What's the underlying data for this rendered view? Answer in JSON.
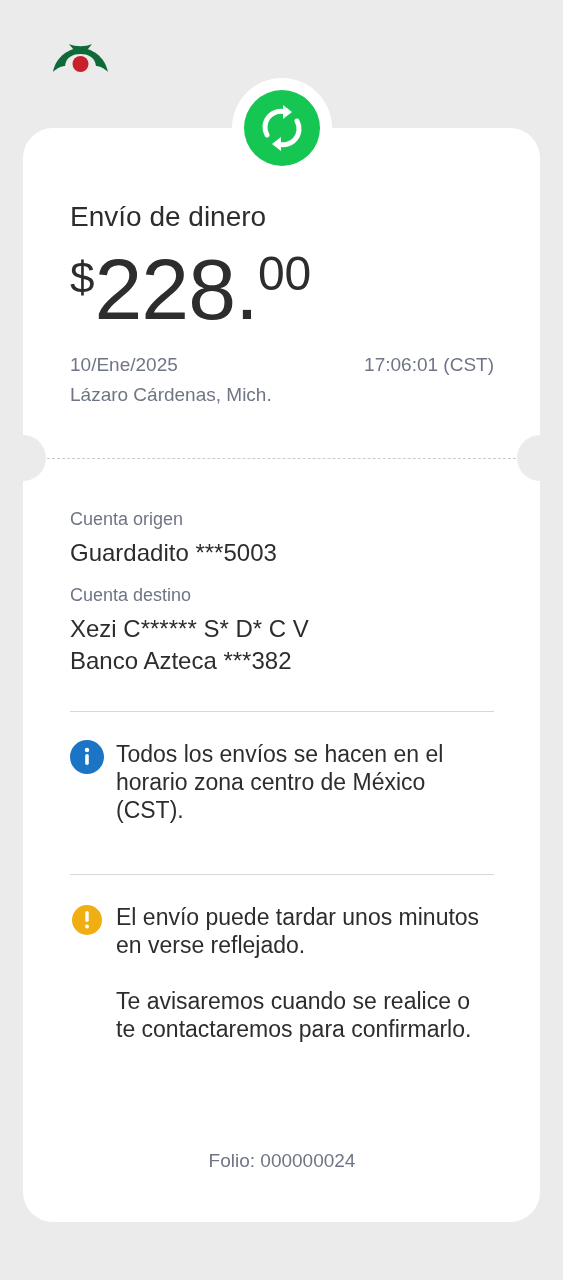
{
  "title": "Envío de dinero",
  "amount": {
    "currency": "$",
    "integer": "228.",
    "cents": "00"
  },
  "date": "10/Ene/2025",
  "time": "17:06:01 (CST)",
  "place": "Lázaro Cárdenas, Mich.",
  "accounts": [
    {
      "label": "Cuenta origen",
      "lines": [
        "Guardadito ***5003"
      ]
    },
    {
      "label": "Cuenta destino",
      "lines": [
        "Xezi C****** S* D* C V",
        "Banco Azteca ***382"
      ]
    }
  ],
  "notices": [
    {
      "kind": "info",
      "paragraphs": [
        "Todos los envíos se hacen en el horario zona centro de México (CST)."
      ]
    },
    {
      "kind": "warning",
      "paragraphs": [
        "El envío puede tardar unos minutos en verse reflejado.",
        "Te avisaremos cuando se realice o te contactaremos para confirmarlo."
      ]
    }
  ],
  "folio": "Folio: 000000024"
}
